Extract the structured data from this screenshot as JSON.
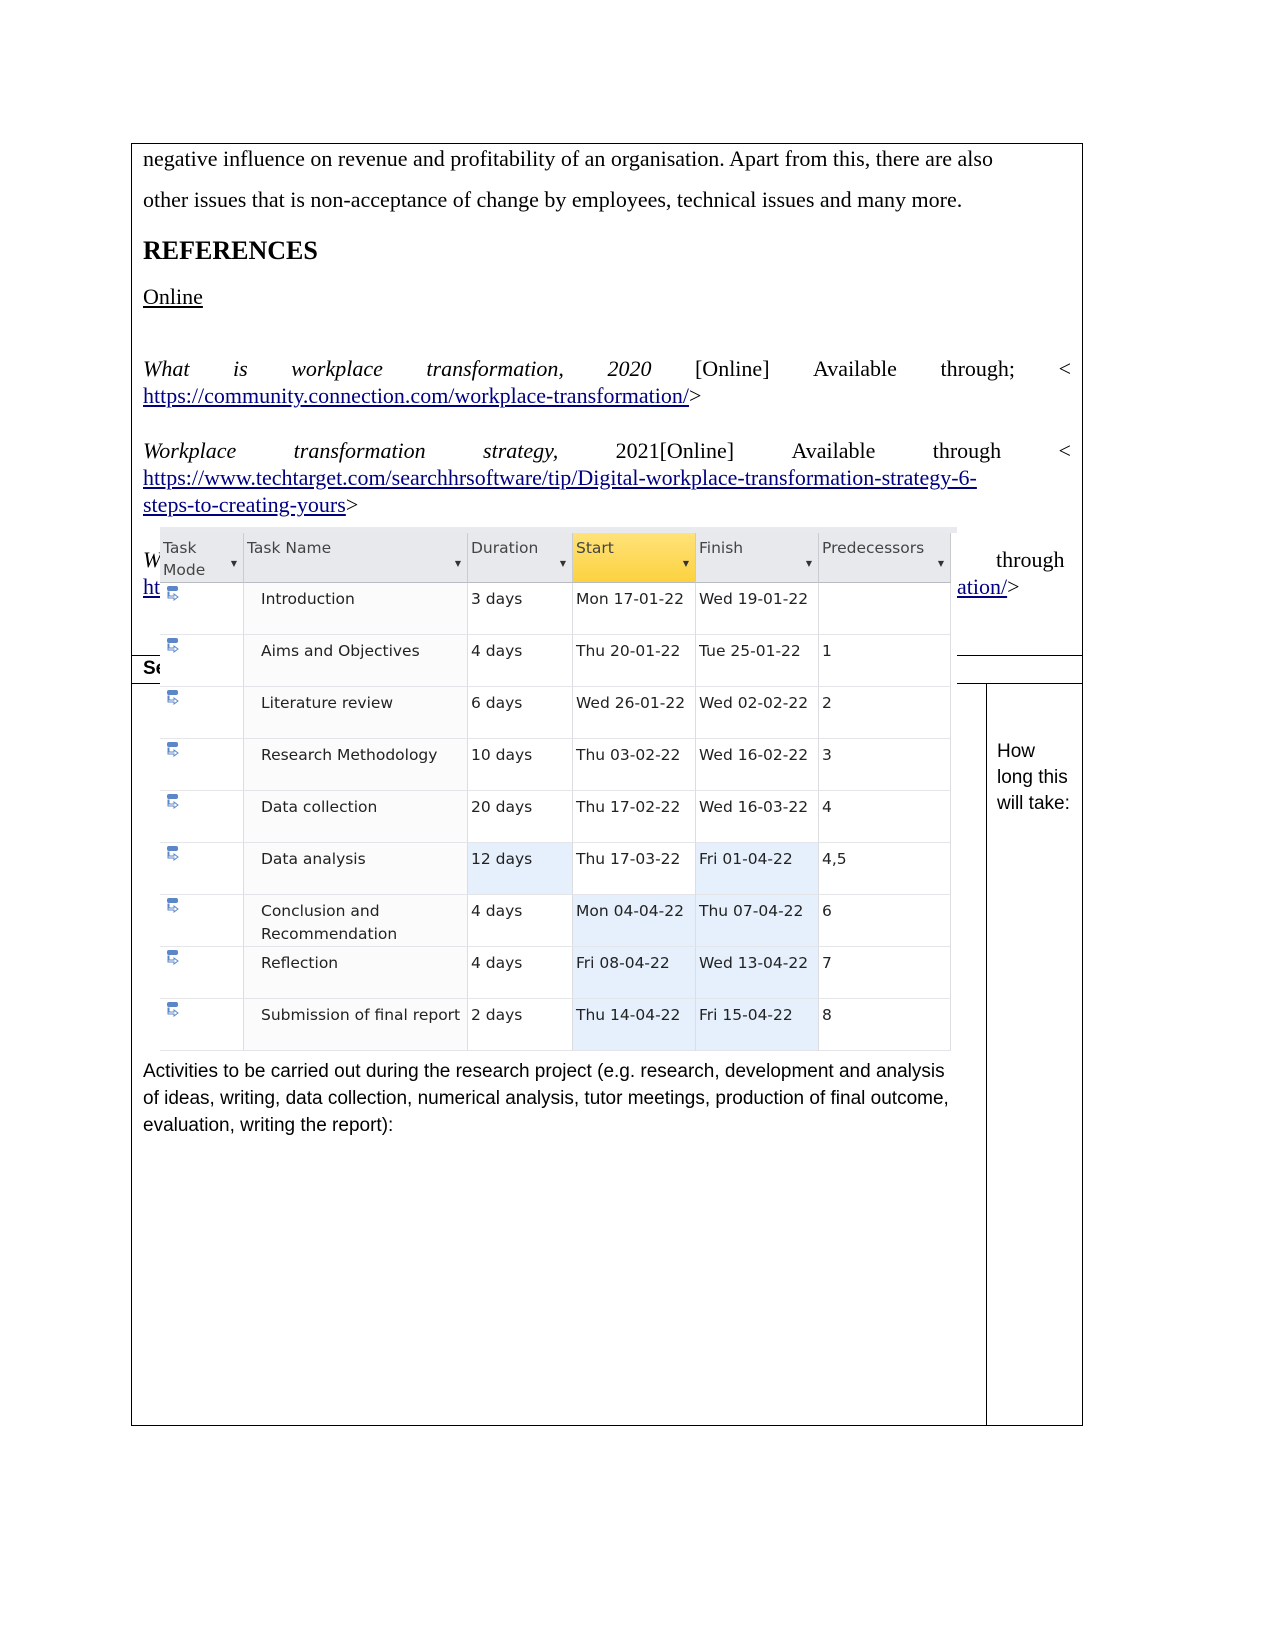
{
  "body": {
    "para_line1": "negative influence on revenue and profitability of an organisation. Apart from this, there are also",
    "para_line2": "other issues that is non-acceptance of change by employees, technical issues and many more.",
    "references_heading": "REFERENCES",
    "online_label": "Online",
    "ref1": {
      "words": [
        "What",
        "is",
        "workplace",
        "transformation,",
        "2020",
        "[Online]",
        "Available",
        "through;",
        "<"
      ],
      "url": "https://community.connection.com/workplace-transformation/",
      "end": ">"
    },
    "ref2": {
      "words": [
        "Workplace",
        "transformation",
        "strategy,",
        "2021[Online]",
        "Available",
        "through",
        "<"
      ],
      "url_line1": "https://www.techtarget.com/searchhrsoftware/tip/Digital-workplace-transformation-strategy-6-",
      "url_line2": "steps-to-creating-yours",
      "end": ">"
    },
    "ref3_partial": {
      "start": "W",
      "through": "through",
      "url_start": "ht",
      "url_end": "ation/",
      "end": ">"
    },
    "section_partial": "Se",
    "how_long": "How long this will take:",
    "activities": "Activities to be carried out during the research project (e.g. research, development and analysis of ideas, writing, data collection, numerical analysis, tutor meetings, production of final outcome, evaluation, writing the report):"
  },
  "project_table": {
    "columns": [
      "Task Mode",
      "Task Name",
      "Duration",
      "Start",
      "Finish",
      "Predecessors"
    ],
    "selected_column": "Start",
    "highlight_color": "#e6f0fc",
    "rows": [
      {
        "name": "Introduction",
        "duration": "3 days",
        "start": "Mon 17-01-22",
        "finish": "Wed 19-01-22",
        "pred": "",
        "hl": []
      },
      {
        "name": "Aims and Objectives",
        "duration": "4 days",
        "start": "Thu 20-01-22",
        "finish": "Tue 25-01-22",
        "pred": "1",
        "hl": []
      },
      {
        "name": "Literature review",
        "duration": "6 days",
        "start": "Wed 26-01-22",
        "finish": "Wed 02-02-22",
        "pred": "2",
        "hl": []
      },
      {
        "name": "Research Methodology",
        "duration": "10 days",
        "start": "Thu 03-02-22",
        "finish": "Wed 16-02-22",
        "pred": "3",
        "hl": []
      },
      {
        "name": "Data collection",
        "duration": "20 days",
        "start": "Thu 17-02-22",
        "finish": "Wed 16-03-22",
        "pred": "4",
        "hl": []
      },
      {
        "name": "Data analysis",
        "duration": "12 days",
        "start": "Thu 17-03-22",
        "finish": "Fri 01-04-22",
        "pred": "4,5",
        "hl": [
          "duration",
          "finish"
        ]
      },
      {
        "name": "Conclusion and Recommendation",
        "duration": "4 days",
        "start": "Mon 04-04-22",
        "finish": "Thu 07-04-22",
        "pred": "6",
        "hl": [
          "start",
          "finish"
        ]
      },
      {
        "name": "Reflection",
        "duration": "4 days",
        "start": "Fri 08-04-22",
        "finish": "Wed 13-04-22",
        "pred": "7",
        "hl": [
          "start",
          "finish"
        ]
      },
      {
        "name": "Submission of final report",
        "duration": "2 days",
        "start": "Thu 14-04-22",
        "finish": "Fri 15-04-22",
        "pred": "8",
        "hl": [
          "start",
          "finish"
        ]
      }
    ],
    "task_mode_icon": "auto-scheduled-task-icon"
  }
}
